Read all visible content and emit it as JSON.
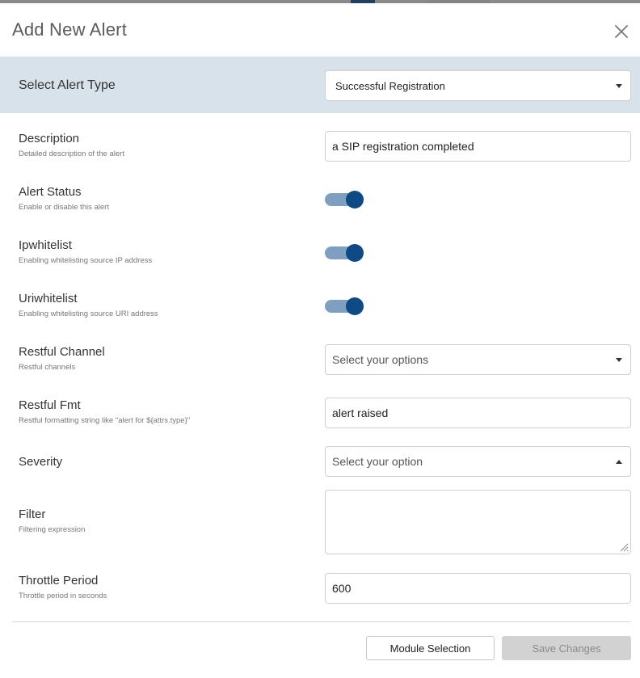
{
  "colors": {
    "accent": "#0e4a85",
    "toggle_track": "#7f9fc0",
    "header_band": "#d8e2eb",
    "disabled_button": "#d2d2d2"
  },
  "modal": {
    "title": "Add New Alert",
    "close_icon": "close-icon"
  },
  "alert_type": {
    "label": "Select Alert Type",
    "selected": "Successful Registration"
  },
  "fields": {
    "description": {
      "label": "Description",
      "help": "Detailed description of the alert",
      "value": "a SIP registration completed"
    },
    "alert_status": {
      "label": "Alert Status",
      "help": "Enable or disable this alert",
      "enabled": true
    },
    "ipwhitelist": {
      "label": "Ipwhitelist",
      "help": "Enabling whitelisting source IP address",
      "enabled": true
    },
    "uriwhitelist": {
      "label": "Uriwhitelist",
      "help": "Enabling whitelisting source URI address",
      "enabled": true
    },
    "restful_channel": {
      "label": "Restful Channel",
      "help": "Restful channels",
      "placeholder": "Select your options"
    },
    "restful_fmt": {
      "label": "Restful Fmt",
      "help": "Restful formatting string like \"alert for ${attrs.type}\"",
      "value": "alert raised"
    },
    "severity": {
      "label": "Severity",
      "placeholder": "Select your option"
    },
    "filter": {
      "label": "Filter",
      "help": "Filtering expression",
      "value": ""
    },
    "throttle_period": {
      "label": "Throttle Period",
      "help": "Throttle period in seconds",
      "value": "600"
    }
  },
  "footer": {
    "module_selection_label": "Module Selection",
    "save_label": "Save Changes"
  }
}
